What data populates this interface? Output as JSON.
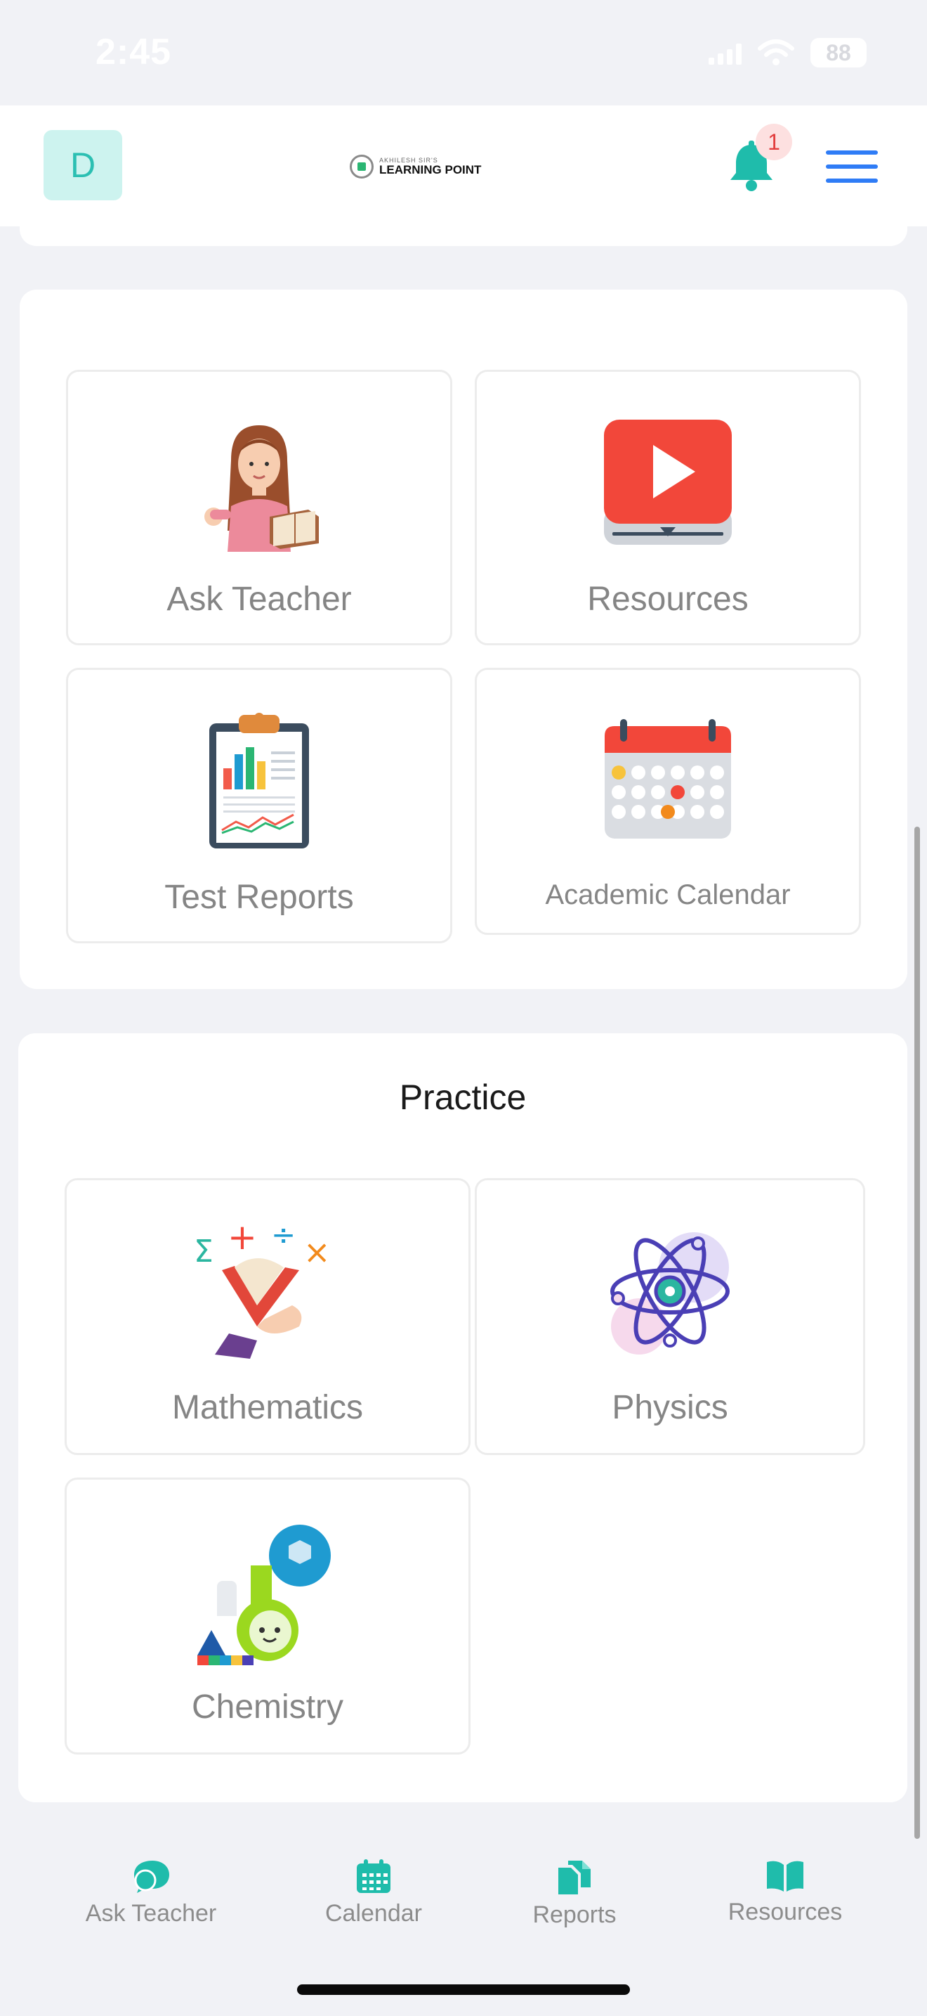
{
  "status_bar": {
    "time": "2:45",
    "battery": "88"
  },
  "header": {
    "avatar_letter": "D",
    "logo_small": "AKHILESH SIR'S",
    "logo_title": "LEARNING POINT",
    "notification_count": "1"
  },
  "quick_links": [
    {
      "label": "Ask Teacher",
      "icon": "teacher-icon"
    },
    {
      "label": "Resources",
      "icon": "video-play-icon"
    },
    {
      "label": "Test Reports",
      "icon": "clipboard-chart-icon"
    },
    {
      "label": "Academic Calendar",
      "icon": "calendar-icon"
    }
  ],
  "practice": {
    "title": "Practice",
    "subjects": [
      {
        "label": "Mathematics",
        "icon": "math-book-icon"
      },
      {
        "label": "Physics",
        "icon": "atom-icon"
      },
      {
        "label": "Chemistry",
        "icon": "flask-icon"
      }
    ]
  },
  "bottom_nav": [
    {
      "label": "Ask Teacher",
      "icon": "chat-bubble-icon"
    },
    {
      "label": "Calendar",
      "icon": "calendar-icon"
    },
    {
      "label": "Reports",
      "icon": "documents-icon"
    },
    {
      "label": "Resources",
      "icon": "open-book-icon"
    }
  ],
  "colors": {
    "accent_teal": "#1fbcab",
    "menu_blue": "#2f7cf6",
    "badge_red": "#e23e3e"
  }
}
